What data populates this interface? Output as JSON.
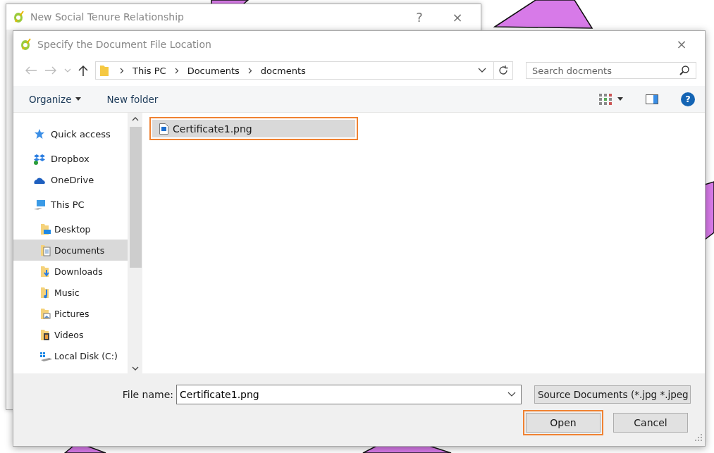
{
  "back_window": {
    "title": "New Social Tenure Relationship",
    "help": "?",
    "close": "×"
  },
  "dialog": {
    "title": "Specify the Document File Location",
    "close": "×"
  },
  "address": {
    "path": [
      "This PC",
      "Documents",
      "docments"
    ],
    "search_placeholder": "Search docments"
  },
  "toolbar": {
    "organize": "Organize",
    "new_folder": "New folder",
    "help": "?"
  },
  "nav": [
    {
      "label": "Quick access",
      "selected": false
    },
    {
      "label": "Dropbox",
      "selected": false
    },
    {
      "label": "OneDrive",
      "selected": false
    },
    {
      "label": "This PC",
      "selected": false,
      "children": [
        {
          "label": "Desktop",
          "selected": false
        },
        {
          "label": "Documents",
          "selected": true
        },
        {
          "label": "Downloads",
          "selected": false
        },
        {
          "label": "Music",
          "selected": false
        },
        {
          "label": "Pictures",
          "selected": false
        },
        {
          "label": "Videos",
          "selected": false
        },
        {
          "label": "Local Disk (C:)",
          "selected": false
        }
      ]
    }
  ],
  "files": [
    {
      "name": "Certificate1.png",
      "selected": true,
      "highlighted": true
    }
  ],
  "footer": {
    "file_name_label": "File name:",
    "file_name": "Certificate1.png",
    "filter": "Source Documents (*.jpg *.jpeg",
    "buttons": [
      {
        "label": "Open",
        "highlighted": true
      },
      {
        "label": "Cancel",
        "highlighted": false
      }
    ]
  }
}
